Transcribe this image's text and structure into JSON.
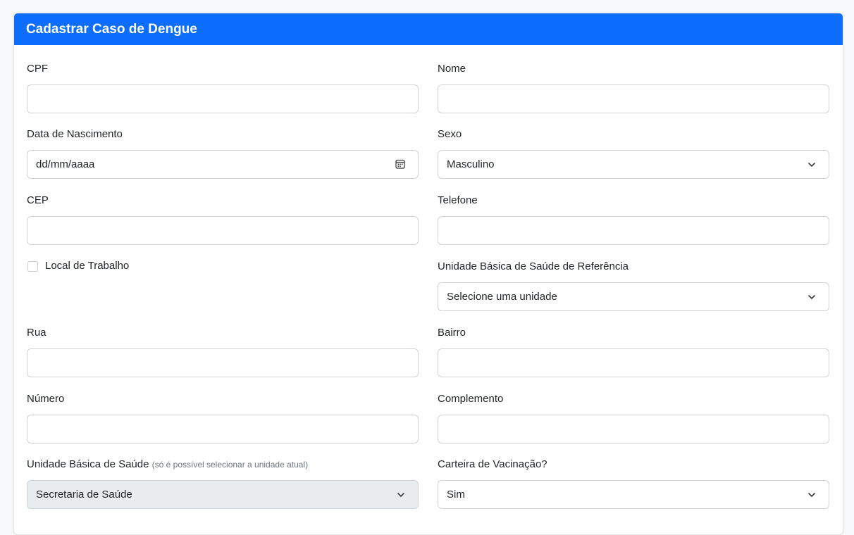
{
  "form": {
    "title": "Cadastrar Caso de Dengue",
    "cpf": {
      "label": "CPF",
      "value": ""
    },
    "nome": {
      "label": "Nome",
      "value": ""
    },
    "data_nascimento": {
      "label": "Data de Nascimento",
      "placeholder": "dd/mm/aaaa",
      "icon": "calendar-icon"
    },
    "sexo": {
      "label": "Sexo",
      "selected": "Masculino"
    },
    "cep": {
      "label": "CEP",
      "value": ""
    },
    "telefone": {
      "label": "Telefone",
      "value": ""
    },
    "local_trabalho": {
      "label": "Local de Trabalho",
      "checked": false
    },
    "ubs_referencia": {
      "label": "Unidade Básica de Saúde de Referência",
      "selected": "Selecione uma unidade"
    },
    "rua": {
      "label": "Rua",
      "value": ""
    },
    "bairro": {
      "label": "Bairro",
      "value": ""
    },
    "numero": {
      "label": "Número",
      "value": ""
    },
    "complemento": {
      "label": "Complemento",
      "value": ""
    },
    "ubs": {
      "label": "Unidade Básica de Saúde",
      "hint": "(só é possível selecionar a unidade atual)",
      "selected": "Secretaria de Saúde"
    },
    "carteira_vacinacao": {
      "label": "Carteira de Vacinação?",
      "selected": "Sim"
    }
  },
  "colors": {
    "header": "#0d6efd",
    "disabled_bg": "#e9ecef",
    "border": "#ced4da"
  }
}
